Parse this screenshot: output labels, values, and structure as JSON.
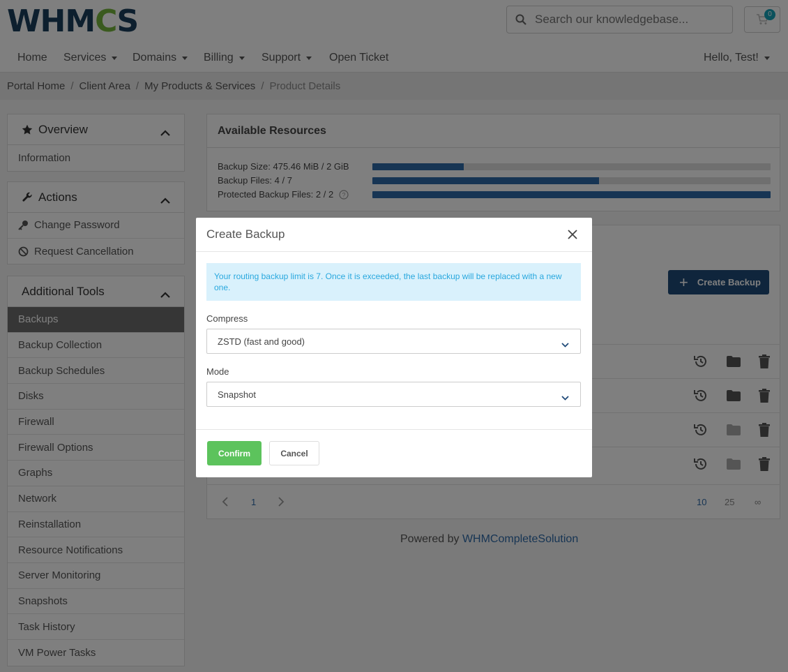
{
  "brand": {
    "logo_text_a": "WHM",
    "logo_text_gear": "C",
    "logo_text_b": "S",
    "accent": "#74b43c"
  },
  "search": {
    "placeholder": "Search our knowledgebase..."
  },
  "cart": {
    "count": "0"
  },
  "nav": {
    "items": [
      {
        "label": "Home"
      },
      {
        "label": "Services"
      },
      {
        "label": "Domains"
      },
      {
        "label": "Billing"
      },
      {
        "label": "Support"
      },
      {
        "label": "Open Ticket"
      }
    ],
    "user": "Hello, Test!"
  },
  "breadcrumb": [
    "Portal Home",
    "Client Area",
    "My Products & Services",
    "Product Details"
  ],
  "sidebar": {
    "overview": {
      "title": "Overview",
      "items": [
        "Information"
      ]
    },
    "actions": {
      "title": "Actions",
      "items": [
        "Change Password",
        "Request Cancellation"
      ]
    },
    "tools": {
      "title": "Additional Tools",
      "items": [
        "Backups",
        "Backup Collection",
        "Backup Schedules",
        "Disks",
        "Firewall",
        "Firewall Options",
        "Graphs",
        "Network",
        "Reinstallation",
        "Resource Notifications",
        "Server Monitoring",
        "Snapshots",
        "Task History",
        "VM Power Tasks"
      ]
    }
  },
  "resources": {
    "title": "Available Resources",
    "rows": [
      {
        "label": "Backup Size: 475.46 MiB / 2 GiB",
        "fill": 0.23
      },
      {
        "label": "Backup Files: 4 / 7",
        "fill": 0.57
      },
      {
        "label": "Protected Backup Files: 2 / 2",
        "fill": 1.0
      }
    ]
  },
  "backups": {
    "create_label": "Create Backup",
    "pagination": {
      "page": "1",
      "sizes": [
        "10",
        "25",
        "∞"
      ]
    }
  },
  "footer": {
    "prefix": "Powered by ",
    "link": "WHMCompleteSolution"
  },
  "modal": {
    "title": "Create Backup",
    "alert": "Your routing backup limit is 7. Once it is exceeded, the last backup will be replaced with a new one.",
    "compress_label": "Compress",
    "compress_value": "ZSTD (fast and good)",
    "mode_label": "Mode",
    "mode_value": "Snapshot",
    "confirm": "Confirm",
    "cancel": "Cancel"
  }
}
